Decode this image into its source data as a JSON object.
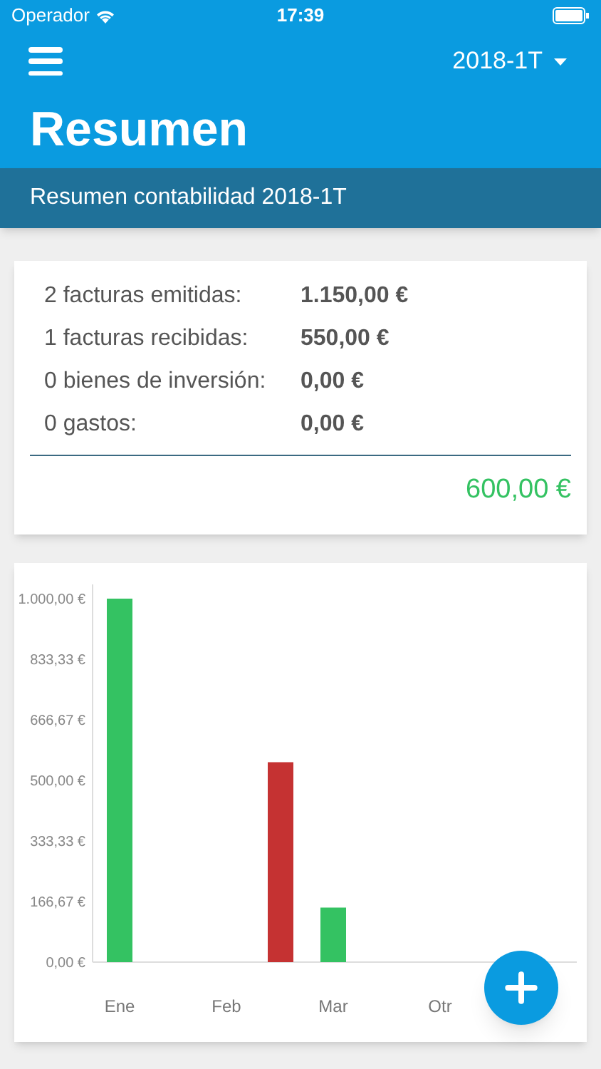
{
  "status_bar": {
    "carrier": "Operador",
    "time": "17:39"
  },
  "header": {
    "period": "2018-1T",
    "title": "Resumen"
  },
  "subheader": {
    "title": "Resumen contabilidad 2018-1T"
  },
  "summary": {
    "rows": [
      {
        "label": "2 facturas emitidas:",
        "value": "1.150,00 €"
      },
      {
        "label": "1 facturas recibidas:",
        "value": "550,00 €"
      },
      {
        "label": "0 bienes de inversión:",
        "value": "0,00 €"
      },
      {
        "label": "0 gastos:",
        "value": "0,00 €"
      }
    ],
    "total": "600,00 €"
  },
  "chart": {
    "chart_data": {
      "type": "bar",
      "stacked": false,
      "categories": [
        "Ene",
        "Feb",
        "Mar",
        "Otr"
      ],
      "ylim": [
        0,
        1000
      ],
      "yticks": [
        {
          "value": 0,
          "label": "0,00 €"
        },
        {
          "value": 166.67,
          "label": "166,67 €"
        },
        {
          "value": 333.33,
          "label": "333,33 €"
        },
        {
          "value": 500,
          "label": "500,00 €"
        },
        {
          "value": 666.67,
          "label": "666,67 €"
        },
        {
          "value": 833.33,
          "label": "833,33 €"
        },
        {
          "value": 1000,
          "label": "1.000,00 €"
        }
      ],
      "series": [
        {
          "color": "#34c262",
          "values": [
            1000,
            0,
            150,
            0
          ]
        },
        {
          "color": "#c53232",
          "values": [
            0,
            550,
            0,
            0
          ]
        }
      ]
    }
  }
}
